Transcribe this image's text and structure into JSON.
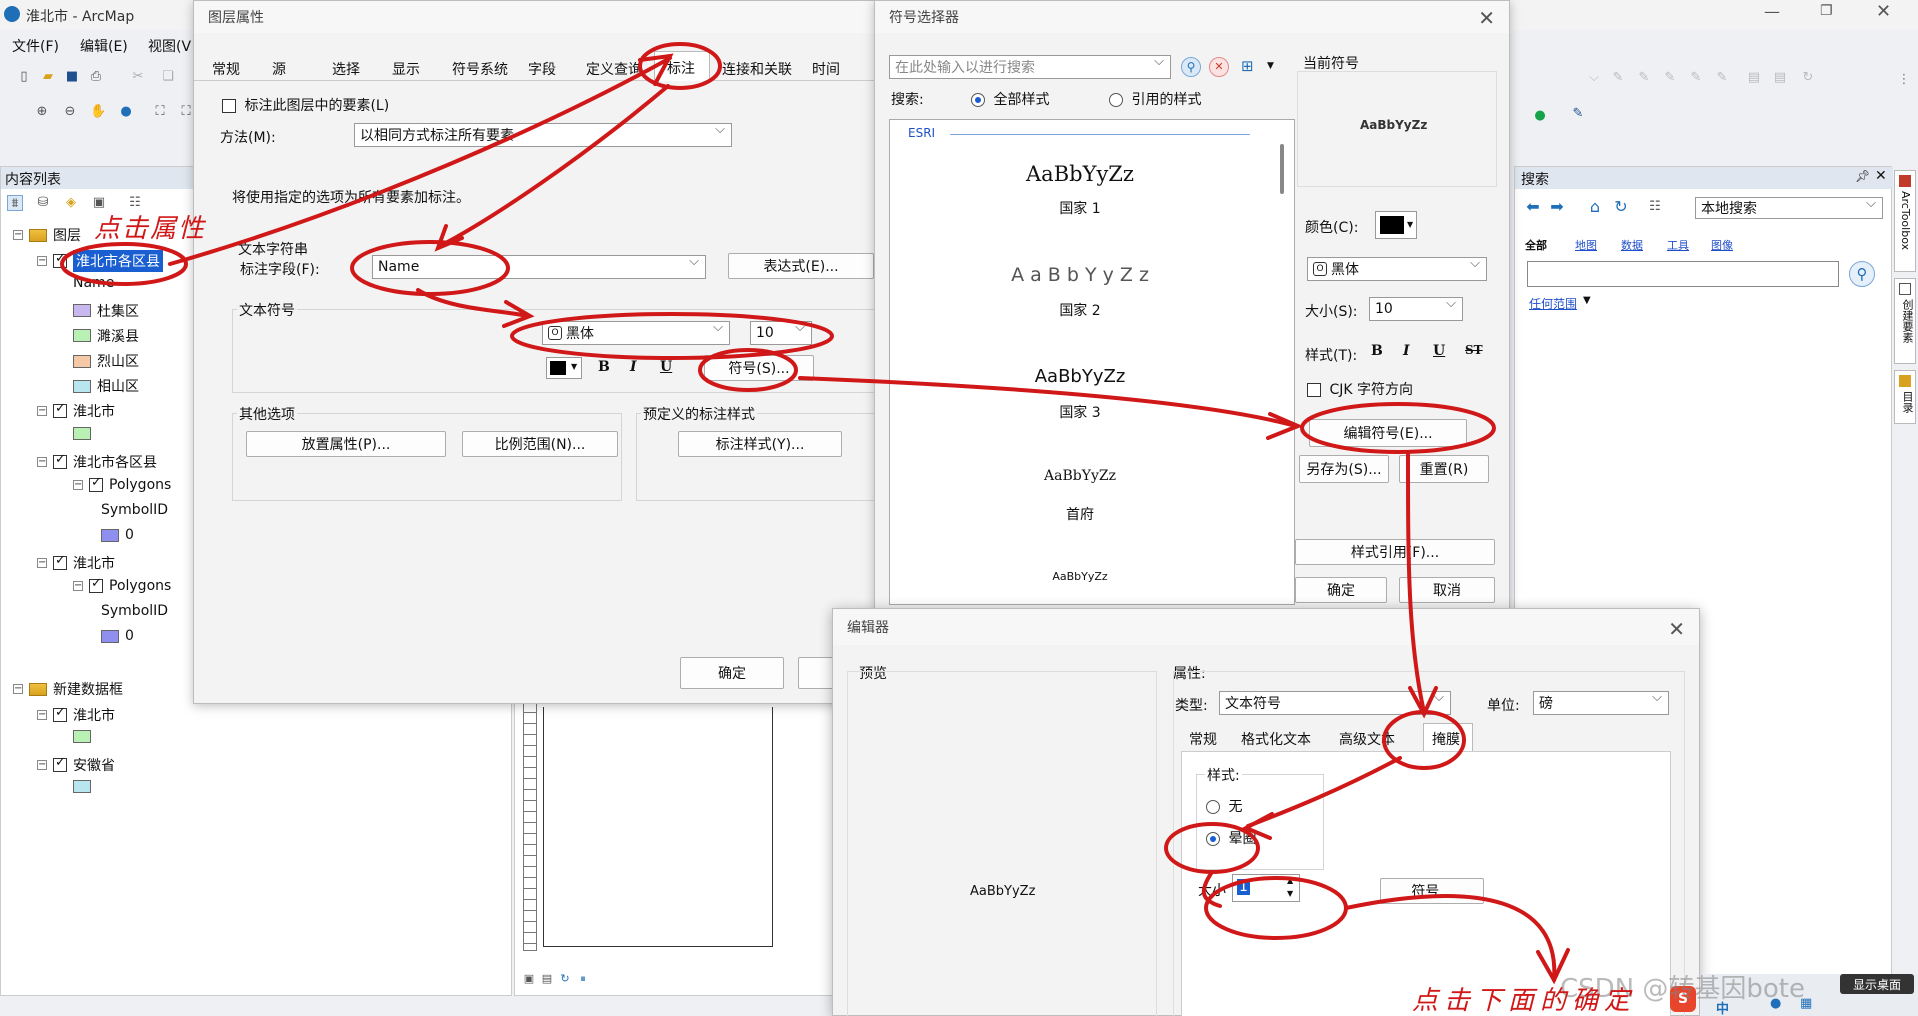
{
  "app": {
    "title": "淮北市 - ArcMap",
    "menu": [
      "文件(F)",
      "编辑(E)",
      "视图(V"
    ]
  },
  "toc": {
    "title": "内容列表",
    "items": [
      {
        "text": "图层",
        "level": 0,
        "type": "frame"
      },
      {
        "text": "淮北市各区县",
        "level": 1,
        "type": "layer",
        "selected": true
      },
      {
        "text": "Name",
        "level": 2,
        "type": "field"
      },
      {
        "text": "杜集区",
        "level": 2,
        "type": "legend",
        "color": "#c9b8f0"
      },
      {
        "text": "濉溪县",
        "level": 2,
        "type": "legend",
        "color": "#b9f0b4"
      },
      {
        "text": "烈山区",
        "level": 2,
        "type": "legend",
        "color": "#f5c8a8"
      },
      {
        "text": "相山区",
        "level": 2,
        "type": "legend",
        "color": "#b8e6f0"
      },
      {
        "text": "淮北市",
        "level": 1,
        "type": "layer"
      },
      {
        "text": "",
        "level": 2,
        "type": "legend",
        "color": "#b9f0b4"
      },
      {
        "text": "淮北市各区县",
        "level": 1,
        "type": "layer"
      },
      {
        "text": "Polygons",
        "level": 2,
        "type": "sub"
      },
      {
        "text": "SymbolID",
        "level": 3,
        "type": "field"
      },
      {
        "text": "0",
        "level": 3,
        "type": "legend",
        "color": "#8f8ff0"
      },
      {
        "text": "淮北市",
        "level": 1,
        "type": "layer"
      },
      {
        "text": "Polygons",
        "level": 2,
        "type": "sub"
      },
      {
        "text": "SymbolID",
        "level": 3,
        "type": "field"
      },
      {
        "text": "0",
        "level": 3,
        "type": "legend",
        "color": "#8f8ff0"
      },
      {
        "text": "新建数据框",
        "level": 0,
        "type": "frame"
      },
      {
        "text": "淮北市",
        "level": 1,
        "type": "layer"
      },
      {
        "text": "",
        "level": 2,
        "type": "legend",
        "color": "#b9f0b4"
      },
      {
        "text": "安徽省",
        "level": 1,
        "type": "layer"
      },
      {
        "text": "",
        "level": 2,
        "type": "legend",
        "color": "#b8e6f0"
      }
    ]
  },
  "layer_props": {
    "title": "图层属性",
    "tabs": [
      "常规",
      "源",
      "选择",
      "显示",
      "符号系统",
      "字段",
      "定义查询",
      "标注",
      "连接和关联",
      "时间"
    ],
    "active_tab": "标注",
    "label_features": "标注此图层中的要素(L)",
    "method_label": "方法(M):",
    "method_value": "以相同方式标注所有要素",
    "info": "将使用指定的选项为所有要素加标注。",
    "text_string": "文本字符串",
    "label_field": "标注字段(F):",
    "label_field_value": "Name",
    "expression_btn": "表达式(E)...",
    "text_symbol": "文本符号",
    "font": "黑体",
    "size": "10",
    "bold": "B",
    "italic": "I",
    "underline": "U",
    "symbol_btn": "符号(S)...",
    "other_options": "其他选项",
    "placement_btn": "放置属性(P)...",
    "scale_btn": "比例范围(N)...",
    "predefined": "预定义的标注样式",
    "label_style_btn": "标注样式(Y)...",
    "ok": "确定"
  },
  "symbol_selector": {
    "title": "符号选择器",
    "search_placeholder": "在此处输入以进行搜索",
    "search_label": "搜索:",
    "all_styles": "全部样式",
    "referenced_styles": "引用的样式",
    "group": "ESRI",
    "symbols": [
      {
        "sample": "AaBbYyZz",
        "name": "国家 1"
      },
      {
        "sample": "A a B b Y y Z z",
        "name": "国家 2"
      },
      {
        "sample": "AaBbYyZz",
        "name": "国家 3"
      },
      {
        "sample": "AaBbYyZz",
        "name": "首府"
      },
      {
        "sample": "AaBbYyZz",
        "name": ""
      }
    ],
    "current_symbol": "当前符号",
    "preview": "AaBbYyZz",
    "color_label": "颜色(C):",
    "font": "黑体",
    "size_label": "大小(S):",
    "size": "10",
    "style_label": "样式(T):",
    "style_buttons": [
      "B",
      "I",
      "U",
      "ST"
    ],
    "cjk": "CJK 字符方向",
    "edit_symbol": "编辑符号(E)...",
    "save_as": "另存为(S)...",
    "reset": "重置(R)",
    "style_refs": "样式引用(F)...",
    "ok": "确定",
    "cancel": "取消"
  },
  "search_panel": {
    "title": "搜索",
    "scope": "本地搜索",
    "filters": [
      "全部",
      "地图",
      "数据",
      "工具",
      "图像"
    ],
    "any_extent": "任何范围"
  },
  "side_tabs": [
    "ArcToolbox",
    "创建要素",
    "目录"
  ],
  "editor": {
    "title": "编辑器",
    "preview_label": "预览",
    "preview_text": "AaBbYyZz",
    "properties": "属性:",
    "type_label": "类型:",
    "type_value": "文本符号",
    "unit_label": "单位:",
    "unit_value": "磅",
    "tabs": [
      "常规",
      "格式化文本",
      "高级文本",
      "掩膜"
    ],
    "style_label": "样式:",
    "none": "无",
    "halo": "晕圈",
    "size_label": "大小",
    "size_value": "1",
    "symbol_btn": "符号..."
  },
  "annotations": {
    "click_props": "点击属性",
    "click_ok": "点击下面的确定"
  },
  "taskbar": {
    "desktop": "显示桌面",
    "ime": "中"
  },
  "watermark": "CSDN @转基因bote",
  "colors": {
    "annotation": "#d01818",
    "selection": "#1a5fd1",
    "dialog_bg": "#f3f3f3"
  }
}
